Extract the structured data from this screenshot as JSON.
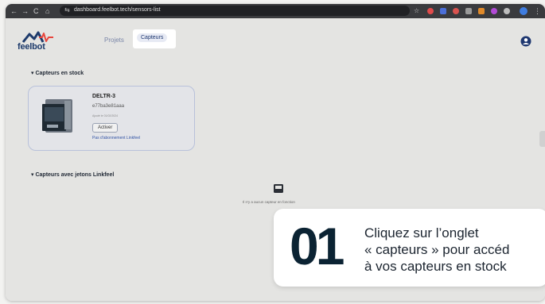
{
  "browser": {
    "url": "dashboard.feelbot.tech/sensors-list",
    "nav_back": "←",
    "nav_forward": "→",
    "nav_reload": "C",
    "nav_home": "⌂",
    "tune_icon": "⇆"
  },
  "brand": {
    "name": "feelbot"
  },
  "tabs": [
    {
      "label": "Projets"
    },
    {
      "label": "Capteurs"
    }
  ],
  "sections": {
    "stock": {
      "title": "Capteurs en stock",
      "card": {
        "name": "DELTR-3",
        "code": "e77ba3e81aaa",
        "sub": "Ajouté le 01/02/2024",
        "button": "Activer",
        "link": "Pas d'abonnement Linkfeel"
      }
    },
    "linkfeel": {
      "title": "Capteurs avec jetons Linkfeel",
      "empty_text": "Il n'y a aucun capteur en fonction"
    }
  },
  "overlay": {
    "step_number": "01",
    "lines": [
      "Cliquez sur l’onglet",
      "« capteurs » pour accéd",
      "à vos capteurs en stock"
    ]
  },
  "colors": {
    "accent": "#1e3770",
    "brand_red": "#e8453c",
    "step_dark": "#0b2333"
  }
}
